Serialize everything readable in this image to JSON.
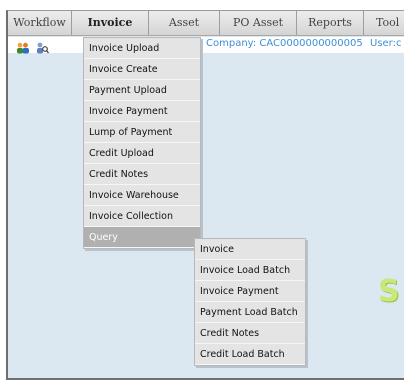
{
  "menubar": {
    "tabs": [
      {
        "label": "Workflow"
      },
      {
        "label": "Invoice"
      },
      {
        "label": "Asset"
      },
      {
        "label": "PO Asset"
      },
      {
        "label": "Reports"
      },
      {
        "label": "Tool"
      }
    ]
  },
  "info": {
    "company": "Company: CAC0000000000005",
    "user": "User:c"
  },
  "invoice_menu": {
    "items": [
      {
        "label": "Invoice Upload"
      },
      {
        "label": "Invoice Create"
      },
      {
        "label": "Payment Upload"
      },
      {
        "label": "Invoice Payment"
      },
      {
        "label": "Lump of Payment"
      },
      {
        "label": "Credit Upload"
      },
      {
        "label": "Credit Notes"
      },
      {
        "label": "Invoice Warehouse"
      },
      {
        "label": "Invoice Collection"
      },
      {
        "label": "Query"
      }
    ]
  },
  "query_submenu": {
    "items": [
      {
        "label": "Invoice"
      },
      {
        "label": "Invoice Load Batch"
      },
      {
        "label": "Invoice Payment"
      },
      {
        "label": "Payment Load Batch"
      },
      {
        "label": "Credit Notes"
      },
      {
        "label": "Credit Load Batch"
      }
    ]
  },
  "welcome_partial": "S",
  "colors": {
    "accent_text": "#3d8fd8",
    "menu_active": "#b0b0b0",
    "background": "#dbe7f1"
  },
  "icons": [
    "users-icon",
    "user-search-icon"
  ]
}
